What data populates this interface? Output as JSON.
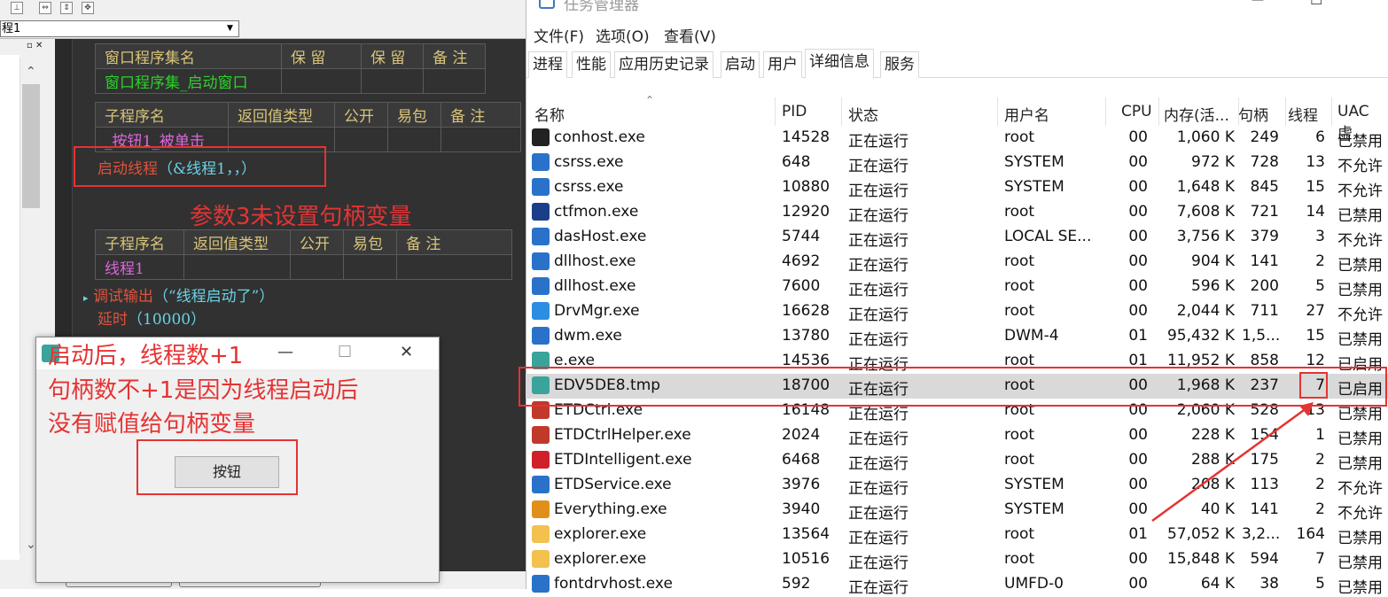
{
  "ide": {
    "combo_value": "程1",
    "table1": {
      "headers": [
        "窗口程序集名",
        "保 留",
        "保 留",
        "备 注"
      ],
      "row": [
        "窗口程序集_启动窗口",
        "",
        "",
        ""
      ]
    },
    "table2": {
      "headers": [
        "子程序名",
        "返回值类型",
        "公开",
        "易包",
        "备 注"
      ],
      "row": [
        "_按钮1_被单击",
        "",
        "",
        "",
        ""
      ]
    },
    "line_start_thread": {
      "kw": "启动线程",
      "args": "（&线程1，，）"
    },
    "table3": {
      "headers": [
        "子程序名",
        "返回值类型",
        "公开",
        "易包",
        "备 注"
      ],
      "row": [
        "线程1",
        "",
        "",
        "",
        ""
      ]
    },
    "line_debug": {
      "kw": "调试输出",
      "args": "（“线程启动了”）"
    },
    "line_delay": {
      "kw": "延时",
      "args": "（10000）"
    }
  },
  "annotations": {
    "param3": "参数3未设置句柄变量",
    "after_start_1": "启动后，线程数+1",
    "after_start_2": "句柄数不+1是因为线程启动后",
    "after_start_3": "没有赋值给句柄变量"
  },
  "small_window": {
    "button_label": "按钮",
    "minimize": "—",
    "maximize": "☐",
    "close": "✕"
  },
  "taskmgr": {
    "title": "任务管理器",
    "menu": [
      "文件(F)",
      "选项(O)",
      "查看(V)"
    ],
    "tabs": [
      "进程",
      "性能",
      "应用历史记录",
      "启动",
      "用户",
      "详细信息",
      "服务"
    ],
    "active_tab": "详细信息",
    "columns": [
      "名称",
      "PID",
      "状态",
      "用户名",
      "CPU",
      "内存(活...",
      "句柄",
      "线程",
      "UAC 虚"
    ],
    "rows": [
      {
        "icon": "console-icon",
        "name": "conhost.exe",
        "pid": "14528",
        "status": "正在运行",
        "user": "root",
        "cpu": "00",
        "mem": "1,060 K",
        "handles": "249",
        "threads": "6",
        "uac": "已禁用"
      },
      {
        "icon": "window-icon",
        "name": "csrss.exe",
        "pid": "648",
        "status": "正在运行",
        "user": "SYSTEM",
        "cpu": "00",
        "mem": "972 K",
        "handles": "728",
        "threads": "13",
        "uac": "不允许"
      },
      {
        "icon": "window-icon",
        "name": "csrss.exe",
        "pid": "10880",
        "status": "正在运行",
        "user": "SYSTEM",
        "cpu": "00",
        "mem": "1,648 K",
        "handles": "845",
        "threads": "15",
        "uac": "不允许"
      },
      {
        "icon": "pen-icon",
        "name": "ctfmon.exe",
        "pid": "12920",
        "status": "正在运行",
        "user": "root",
        "cpu": "00",
        "mem": "7,608 K",
        "handles": "721",
        "threads": "14",
        "uac": "已禁用"
      },
      {
        "icon": "window-icon",
        "name": "dasHost.exe",
        "pid": "5744",
        "status": "正在运行",
        "user": "LOCAL SE...",
        "cpu": "00",
        "mem": "3,756 K",
        "handles": "379",
        "threads": "3",
        "uac": "不允许"
      },
      {
        "icon": "window-icon",
        "name": "dllhost.exe",
        "pid": "4692",
        "status": "正在运行",
        "user": "root",
        "cpu": "00",
        "mem": "904 K",
        "handles": "141",
        "threads": "2",
        "uac": "已禁用"
      },
      {
        "icon": "window-icon",
        "name": "dllhost.exe",
        "pid": "7600",
        "status": "正在运行",
        "user": "root",
        "cpu": "00",
        "mem": "596 K",
        "handles": "200",
        "threads": "5",
        "uac": "已禁用"
      },
      {
        "icon": "drvmgr-icon",
        "name": "DrvMgr.exe",
        "pid": "16628",
        "status": "正在运行",
        "user": "root",
        "cpu": "00",
        "mem": "2,044 K",
        "handles": "711",
        "threads": "27",
        "uac": "不允许"
      },
      {
        "icon": "window-icon",
        "name": "dwm.exe",
        "pid": "13780",
        "status": "正在运行",
        "user": "DWM-4",
        "cpu": "01",
        "mem": "95,432 K",
        "handles": "1,5...",
        "threads": "15",
        "uac": "已禁用"
      },
      {
        "icon": "e-icon",
        "name": "e.exe",
        "pid": "14536",
        "status": "正在运行",
        "user": "root",
        "cpu": "01",
        "mem": "11,952 K",
        "handles": "858",
        "threads": "12",
        "uac": "已启用"
      },
      {
        "icon": "e-icon",
        "name": "EDV5DE8.tmp",
        "pid": "18700",
        "status": "正在运行",
        "user": "root",
        "cpu": "00",
        "mem": "1,968 K",
        "handles": "237",
        "threads": "7",
        "uac": "已启用",
        "selected": true
      },
      {
        "icon": "etd-icon",
        "name": "ETDCtrl.exe",
        "pid": "16148",
        "status": "正在运行",
        "user": "root",
        "cpu": "00",
        "mem": "2,060 K",
        "handles": "528",
        "threads": "13",
        "uac": "已禁用"
      },
      {
        "icon": "etd-icon",
        "name": "ETDCtrlHelper.exe",
        "pid": "2024",
        "status": "正在运行",
        "user": "root",
        "cpu": "00",
        "mem": "228 K",
        "handles": "154",
        "threads": "1",
        "uac": "已禁用"
      },
      {
        "icon": "etd-intelligent-icon",
        "name": "ETDIntelligent.exe",
        "pid": "6468",
        "status": "正在运行",
        "user": "root",
        "cpu": "00",
        "mem": "288 K",
        "handles": "175",
        "threads": "2",
        "uac": "已禁用"
      },
      {
        "icon": "window-icon",
        "name": "ETDService.exe",
        "pid": "3976",
        "status": "正在运行",
        "user": "SYSTEM",
        "cpu": "00",
        "mem": "208 K",
        "handles": "113",
        "threads": "2",
        "uac": "不允许"
      },
      {
        "icon": "magnifier-icon",
        "name": "Everything.exe",
        "pid": "3940",
        "status": "正在运行",
        "user": "SYSTEM",
        "cpu": "00",
        "mem": "40 K",
        "handles": "141",
        "threads": "2",
        "uac": "不允许"
      },
      {
        "icon": "folder-icon",
        "name": "explorer.exe",
        "pid": "13564",
        "status": "正在运行",
        "user": "root",
        "cpu": "01",
        "mem": "57,052 K",
        "handles": "3,2...",
        "threads": "164",
        "uac": "已禁用"
      },
      {
        "icon": "folder-icon",
        "name": "explorer.exe",
        "pid": "10516",
        "status": "正在运行",
        "user": "root",
        "cpu": "00",
        "mem": "15,848 K",
        "handles": "594",
        "threads": "7",
        "uac": "已禁用"
      },
      {
        "icon": "window-icon",
        "name": "fontdrvhost.exe",
        "pid": "592",
        "status": "正在运行",
        "user": "UMFD-0",
        "cpu": "00",
        "mem": "64 K",
        "handles": "38",
        "threads": "5",
        "uac": "已禁用"
      }
    ]
  },
  "colors": {
    "annotation": "#e53333",
    "code_bg": "#313131",
    "header_text": "#d8c478",
    "green": "#2bd22b",
    "pink": "#dd66dd",
    "cyan": "#6ad2e6"
  }
}
